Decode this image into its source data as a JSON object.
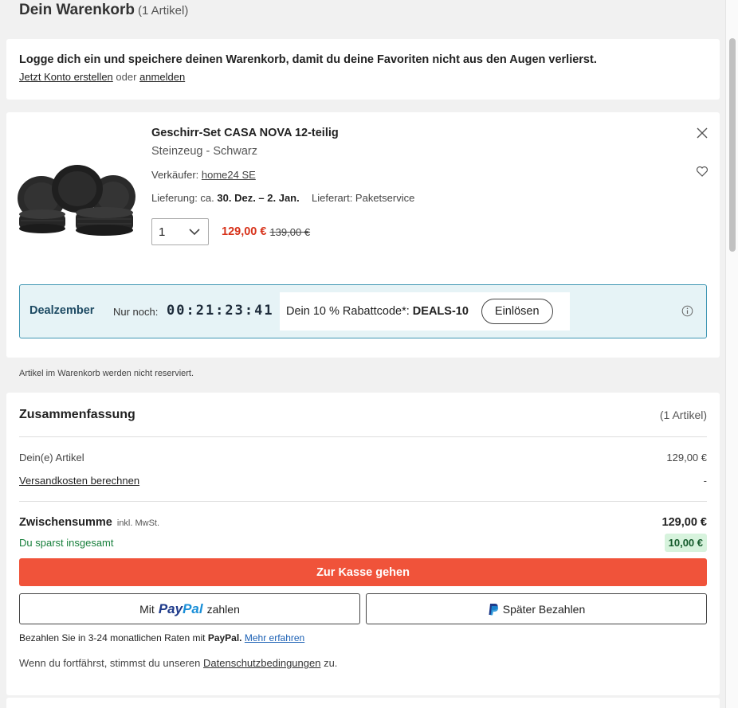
{
  "header": {
    "title": "Dein Warenkorb",
    "count": "(1 Artikel)"
  },
  "login": {
    "message": "Logge dich ein und speichere deinen Warenkorb, damit du deine Favoriten nicht aus den Augen verlierst.",
    "create_link": "Jetzt Konto erstellen",
    "or": "oder",
    "login_link": "anmelden"
  },
  "product": {
    "title": "Geschirr-Set CASA NOVA 12-teilig",
    "subtitle": "Steinzeug - Schwarz",
    "seller_label": "Verkäufer:",
    "seller_name": "home24 SE",
    "delivery_label": "Lieferung: ca.",
    "delivery_dates": "30. Dez. – 2. Jan.",
    "shipping_label": "Lieferart: Paketservice",
    "quantity": "1",
    "price": "129,00 €",
    "old_price": "139,00 €"
  },
  "deal": {
    "title": "Dealzember",
    "remaining_label": "Nur noch:",
    "timer": "00:21:23:41",
    "code_text": "Dein 10 % Rabattcode*:",
    "code": "DEALS-10",
    "redeem_label": "Einlösen"
  },
  "note": "Artikel im Warenkorb werden nicht reserviert.",
  "summary": {
    "title": "Zusammenfassung",
    "count": "(1 Artikel)",
    "items_label": "Dein(e) Artikel",
    "items_value": "129,00 €",
    "shipping_link": "Versandkosten berechnen",
    "shipping_value": "-",
    "subtotal_label": "Zwischensumme",
    "subtotal_note": "inkl. MwSt.",
    "subtotal_value": "129,00 €",
    "savings_label": "Du sparst insgesamt",
    "savings_value": "10,00 €",
    "checkout_label": "Zur Kasse gehen",
    "paypal_prefix": "Mit",
    "paypal_word_1": "Pay",
    "paypal_word_2": "Pal",
    "paypal_suffix": "zahlen",
    "paylater_label": "Später Bezahlen",
    "installments_text": "Bezahlen Sie in 3-24 monatlichen Raten mit",
    "installments_brand": "PayPal.",
    "installments_link": "Mehr erfahren",
    "privacy_prefix": "Wenn du fortfährst, stimmst du unseren",
    "privacy_link": "Datenschutzbedingungen",
    "privacy_suffix": "zu."
  },
  "colors": {
    "checkout": "#f0533a",
    "price": "#d7321a",
    "deal_border": "#3e96b3",
    "deal_bg": "#e6f3f6",
    "savings_bg": "#d7f3dd"
  }
}
